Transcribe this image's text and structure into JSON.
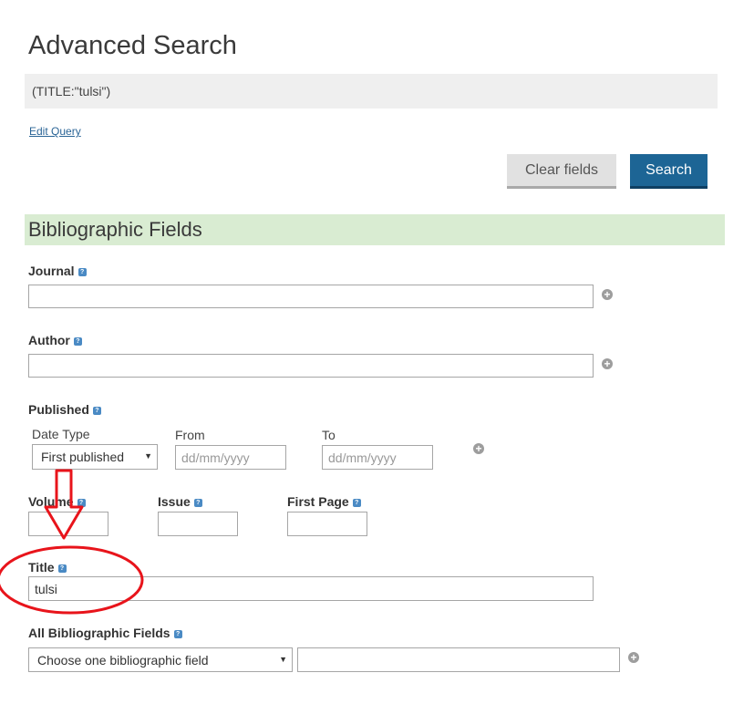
{
  "page": {
    "title": "Advanced Search"
  },
  "query": {
    "text": "(TITLE:\"tulsi\")",
    "edit_link": "Edit Query"
  },
  "buttons": {
    "clear": "Clear fields",
    "search": "Search"
  },
  "section": {
    "title": "Bibliographic Fields"
  },
  "fields": {
    "journal": {
      "label": "Journal",
      "value": ""
    },
    "author": {
      "label": "Author",
      "value": ""
    },
    "published": {
      "label": "Published",
      "date_type_label": "Date Type",
      "date_type_value": "First published",
      "from_label": "From",
      "from_placeholder": "dd/mm/yyyy",
      "to_label": "To",
      "to_placeholder": "dd/mm/yyyy"
    },
    "volume": {
      "label": "Volume",
      "value": ""
    },
    "issue": {
      "label": "Issue",
      "value": ""
    },
    "first_page": {
      "label": "First Page",
      "value": ""
    },
    "title": {
      "label": "Title",
      "value": "tulsi"
    },
    "all_bib": {
      "label": "All Bibliographic Fields",
      "select_value": "Choose one bibliographic field",
      "value": ""
    }
  },
  "icons": {
    "help": "?",
    "plus": "+",
    "dropdown_arrow": "▼"
  },
  "annotation": {
    "color": "#e8141b"
  }
}
